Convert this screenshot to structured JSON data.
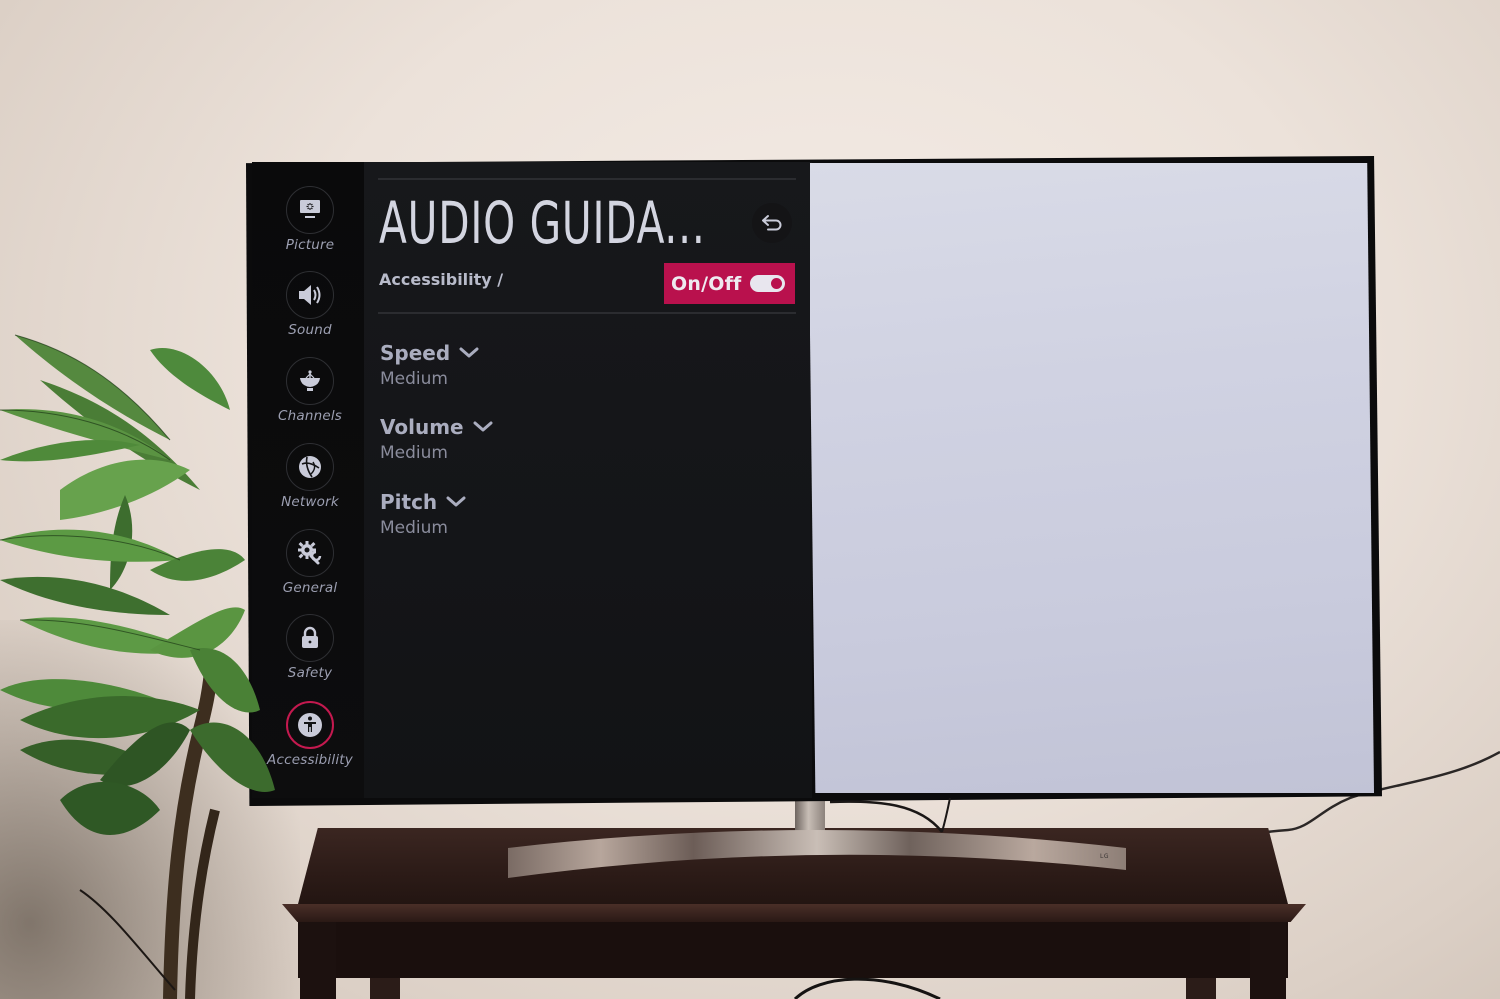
{
  "sidebar": {
    "items": [
      {
        "label": "Picture",
        "icon": "picture-icon",
        "active": false
      },
      {
        "label": "Sound",
        "icon": "speaker-icon",
        "active": false
      },
      {
        "label": "Channels",
        "icon": "satellite-dish-icon",
        "active": false
      },
      {
        "label": "Network",
        "icon": "globe-icon",
        "active": false
      },
      {
        "label": "General",
        "icon": "gear-wrench-icon",
        "active": false
      },
      {
        "label": "Safety",
        "icon": "lock-icon",
        "active": false
      },
      {
        "label": "Accessibility",
        "icon": "accessibility-person-icon",
        "active": true
      }
    ]
  },
  "header": {
    "title": "AUDIO GUIDA...",
    "breadcrumb": "Accessibility /",
    "back_icon": "back-arrow-icon",
    "toggle": {
      "label": "On/Off",
      "state": "on"
    }
  },
  "settings": [
    {
      "name": "Speed",
      "value": "Medium",
      "icon": "chevron-down-icon"
    },
    {
      "name": "Volume",
      "value": "Medium",
      "icon": "chevron-down-icon"
    },
    {
      "name": "Pitch",
      "value": "Medium",
      "icon": "chevron-down-icon"
    }
  ],
  "stand": {
    "brand": "LG"
  },
  "colors": {
    "accent": "#b9114d",
    "active_ring": "#c4194f",
    "text_primary": "#d3d5e0",
    "text_secondary": "#8a8c9c",
    "panel_bg": "#141518"
  }
}
